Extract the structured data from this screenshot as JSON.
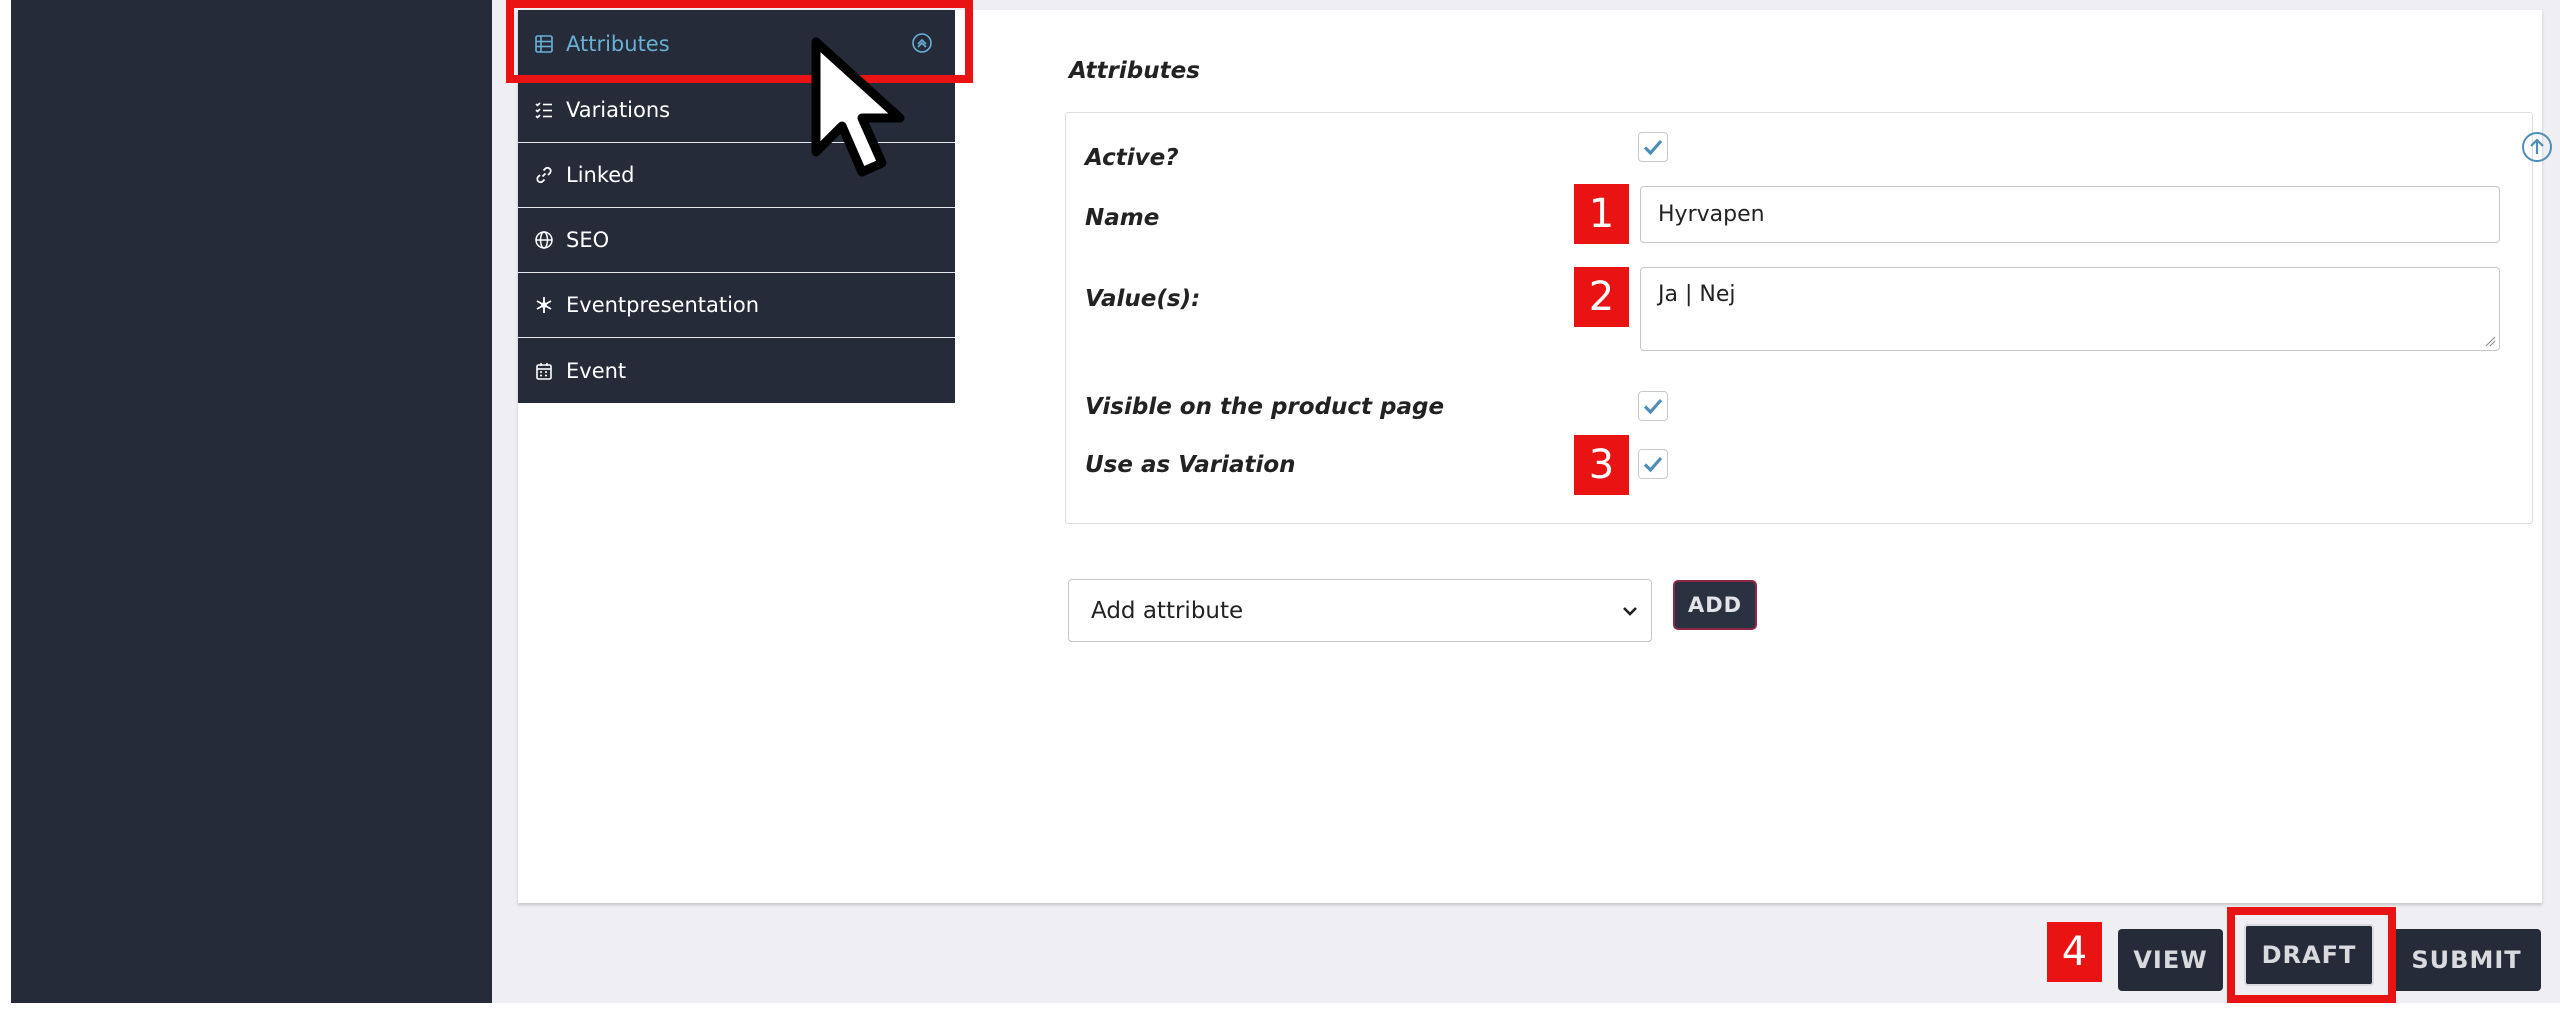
{
  "tabs": [
    {
      "label": "Attributes",
      "icon": "table-icon",
      "active": true
    },
    {
      "label": "Variations",
      "icon": "list-check-icon"
    },
    {
      "label": "Linked",
      "icon": "link-icon"
    },
    {
      "label": "SEO",
      "icon": "globe-icon"
    },
    {
      "label": "Eventpresentation",
      "icon": "snowflake-icon"
    },
    {
      "label": "Event",
      "icon": "calendar-icon"
    }
  ],
  "form": {
    "title": "Attributes",
    "active_label": "Active?",
    "active_checked": true,
    "name_label": "Name",
    "name_value": "Hyrvapen",
    "values_label": "Value(s):",
    "values_value": "Ja | Nej",
    "visible_label": "Visible on the product page",
    "visible_checked": true,
    "variation_label": "Use as Variation",
    "variation_checked": true,
    "add_attribute_selected": "Add attribute",
    "add_button": "ADD"
  },
  "annotations": {
    "badge1": "1",
    "badge2": "2",
    "badge3": "3",
    "badge4": "4"
  },
  "actions": {
    "view": "VIEW",
    "draft": "DRAFT",
    "submit": "SUBMIT"
  },
  "colors": {
    "sidebar": "#252b38",
    "active_tab_text": "#6ab0d6",
    "highlight": "#ea1313",
    "check": "#4d8fb8"
  }
}
